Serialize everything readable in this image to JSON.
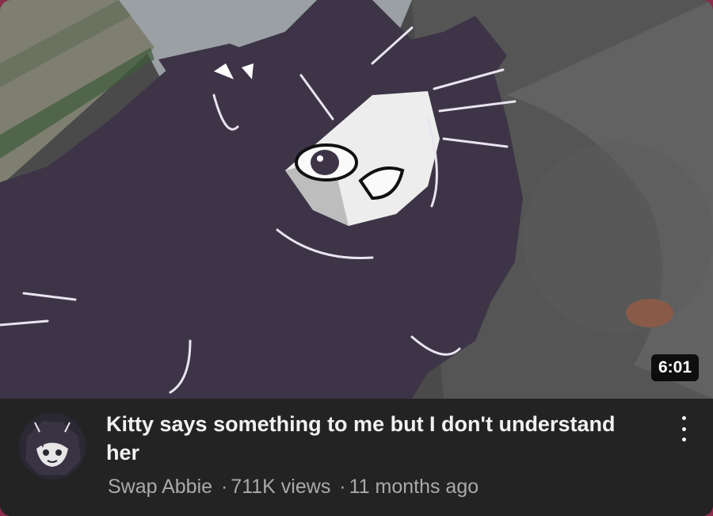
{
  "video": {
    "duration": "6:01",
    "title": "Kitty says something to me but I don't understand her",
    "channel": "Swap Abbie",
    "separator": "·",
    "views": "711K views",
    "age": "11 months ago"
  },
  "icons": {
    "menu": "more-vert-icon"
  },
  "colors": {
    "info_background": "#232323",
    "title_text": "#f1f1f1",
    "meta_text": "#aaaaaa",
    "cat_fur": "#3d3547",
    "border": "#8a2c4a"
  }
}
